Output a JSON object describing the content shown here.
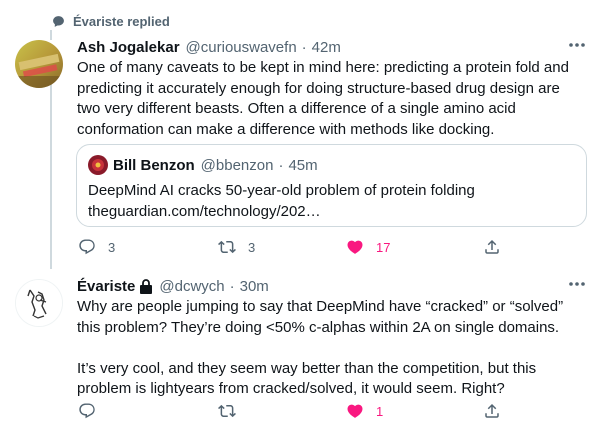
{
  "social_context": {
    "text": "Évariste replied"
  },
  "tweets": [
    {
      "name": "Ash Jogalekar",
      "handle": "@curiouswavefn",
      "time": "42m",
      "lines": [
        "One of many caveats to be kept in mind here: predicting a protein fold and",
        "predicting it accurately enough for doing structure-based drug design are",
        "two very different beasts. Often a difference of a single amino acid",
        "conformation can make a difference with methods like docking."
      ],
      "quote": {
        "name": "Bill Benzon",
        "handle": "@bbenzon",
        "time": "45m",
        "line1": "DeepMind AI cracks 50-year-old problem of protein folding",
        "line2": "theguardian.com/technology/202…"
      },
      "replies": "3",
      "retweets": "3",
      "likes": "17",
      "liked": true
    },
    {
      "name": "Évariste",
      "handle": "@dcwych",
      "time": "30m",
      "protected": true,
      "lines": [
        "Why are people jumping to say that DeepMind have “cracked” or “solved”",
        "this problem? They’re doing <50% c-alphas within 2A on single domains.",
        "",
        "It’s very cool, and they seem way better than the competition, but this",
        "problem is lightyears from cracked/solved, it would seem. Right?"
      ],
      "replies": "",
      "retweets": "",
      "likes": "1",
      "liked": true
    }
  ],
  "colors": {
    "text": "#0f1419",
    "secondary": "#536471",
    "border": "#cfd9de",
    "like": "#f91880"
  },
  "icons": [
    "comment-icon",
    "reply-icon",
    "retweet-icon",
    "heart-icon",
    "share-icon",
    "more-icon",
    "lock-icon"
  ]
}
